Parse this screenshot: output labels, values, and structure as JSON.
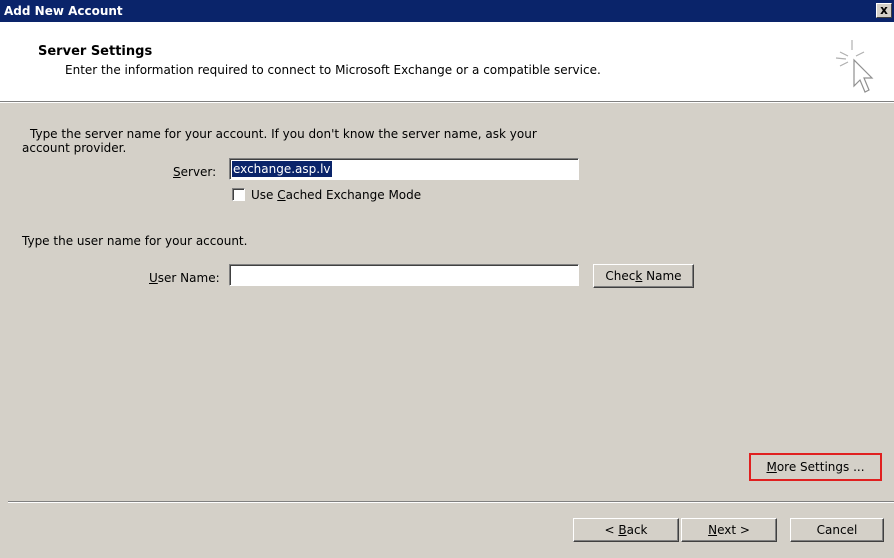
{
  "window": {
    "title": "Add New Account",
    "close_symbol": "x"
  },
  "header": {
    "title": "Server Settings",
    "subtitle": "Enter the information required to connect to Microsoft Exchange or a compatible service."
  },
  "server_section": {
    "instruction_line1": "Type the server name for your account. If you don't know the server name, ask your",
    "instruction_line2": "account provider.",
    "server_label_prefix": "",
    "server_label_underlined": "S",
    "server_label_rest": "erver:",
    "server_value": "exchange.asp.lv",
    "cached_mode_prefix": "Use ",
    "cached_mode_underlined": "C",
    "cached_mode_rest": "ached Exchange Mode",
    "cached_mode_checked": false
  },
  "user_section": {
    "instruction": "Type the user name for your account.",
    "user_label_underlined": "U",
    "user_label_rest": "ser Name:",
    "user_value": "",
    "check_name_prefix": "Chec",
    "check_name_underlined": "k",
    "check_name_rest": " Name"
  },
  "more_settings": {
    "underlined": "M",
    "rest": "ore Settings ..."
  },
  "footer": {
    "back_prefix": "< ",
    "back_underlined": "B",
    "back_rest": "ack",
    "next_underlined": "N",
    "next_rest": "ext >",
    "cancel": "Cancel"
  },
  "colors": {
    "titlebar": "#0a246a",
    "dialog": "#d4d0c8",
    "highlight": "#e02020"
  }
}
